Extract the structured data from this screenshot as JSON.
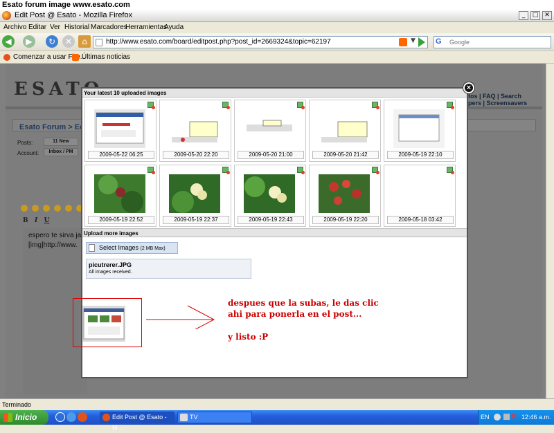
{
  "caption": "Esato forum image www.esato.com",
  "window": {
    "title": "Edit Post @ Esato - Mozilla Firefox",
    "min": "_",
    "max": "□",
    "close": "✕"
  },
  "menu": [
    "Archivo",
    "Editar",
    "Ver",
    "Historial",
    "Marcadores",
    "Herramientas",
    "Ayuda"
  ],
  "nav": {
    "url": "http://www.esato.com/board/editpost.php?post_id=2669324&topic=62197",
    "search_placeholder": "Google"
  },
  "bookmarks": [
    "Comenzar a usar Fire...",
    "Últimas noticias"
  ],
  "page": {
    "logo": "ESATO",
    "topnav_1": "tos  |  FAQ  |  Search",
    "topnav_2": "pers  |  Screensavers",
    "breadcrumb": "Esato Forum > Edit",
    "posts_label": "Posts:",
    "posts_value": "11 New",
    "account_label": "Account:",
    "account_value": "Inbox / PM",
    "editor_line1": "espero te sirva ja",
    "editor_line2": "[img]http://www."
  },
  "modal": {
    "header": "Your latest 10 uploaded images",
    "tiles": [
      {
        "date": "2009-05-22 06:25"
      },
      {
        "date": "2009-05-20 22:20"
      },
      {
        "date": "2009-05-20 21:00"
      },
      {
        "date": "2009-05-20 21:42"
      },
      {
        "date": "2009-05-19 22:10"
      },
      {
        "date": "2009-05-19 22:52"
      },
      {
        "date": "2009-05-19 22:37"
      },
      {
        "date": "2009-05-19 22:43"
      },
      {
        "date": "2009-05-19 22:20"
      },
      {
        "date": "2009-05-18 03:42"
      }
    ],
    "upload_header": "Upload more images",
    "select_button": "Select Images",
    "select_button_note": "(2 MB Max)",
    "file_name": "picutrerer.JPG",
    "file_status": "All images received.",
    "annotation_line1": "despues que la subas, le das clic",
    "annotation_line2": "ahi para ponerla en el post...",
    "annotation_line3": "y listo   :P"
  },
  "status": "Terminado",
  "taskbar": {
    "start": "Inicio",
    "task1": "Edit Post @ Esato - M...",
    "task2": "TV",
    "lang": "EN",
    "clock": "12:46 a.m."
  }
}
